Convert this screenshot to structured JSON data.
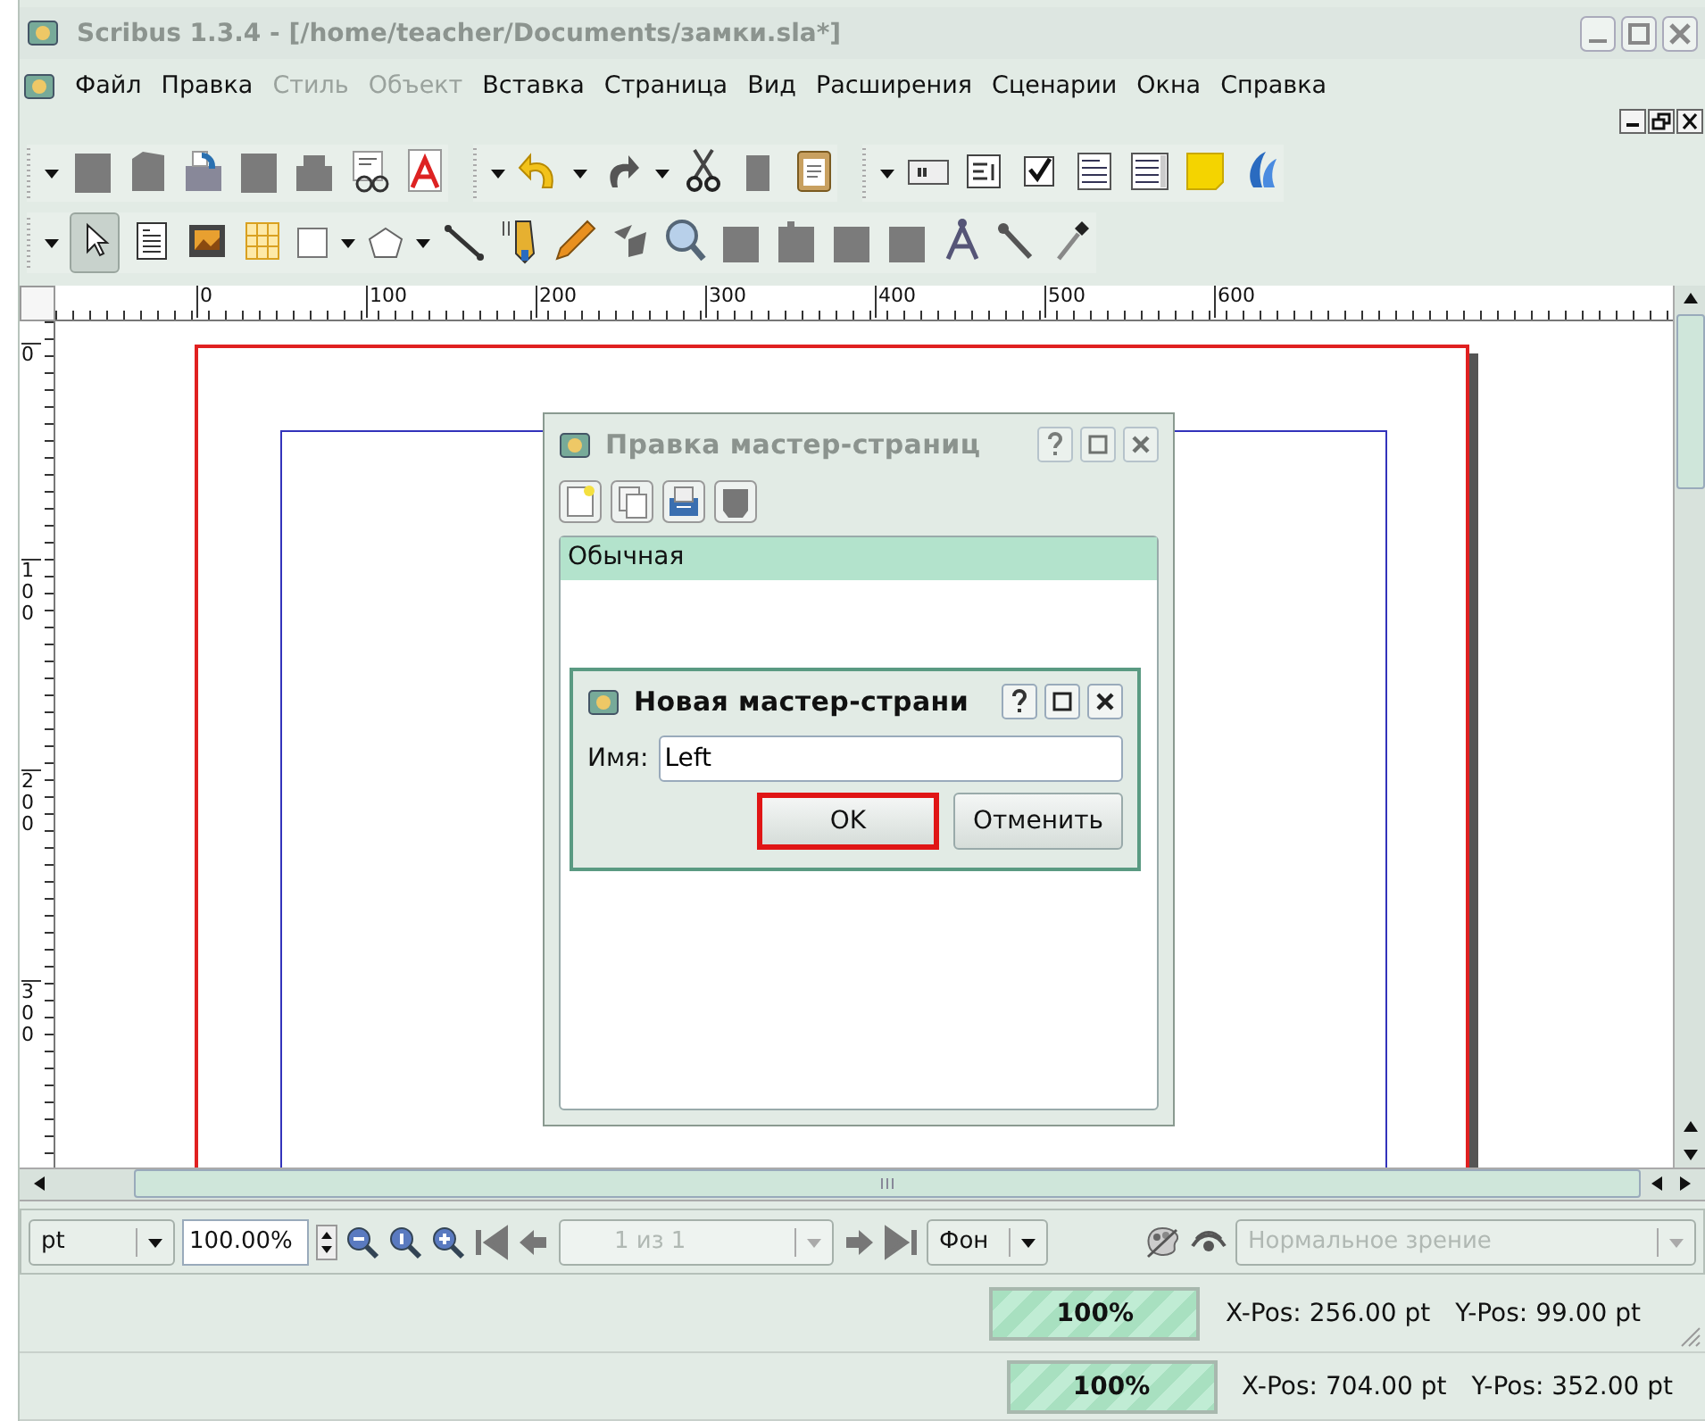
{
  "window": {
    "title": "Scribus 1.3.4 - [/home/teacher/Documents/замки.sla*]"
  },
  "menu": [
    {
      "label": "Файл",
      "disabled": false
    },
    {
      "label": "Правка",
      "disabled": false
    },
    {
      "label": "Стиль",
      "disabled": true
    },
    {
      "label": "Объект",
      "disabled": true
    },
    {
      "label": "Вставка",
      "disabled": false
    },
    {
      "label": "Страница",
      "disabled": false
    },
    {
      "label": "Вид",
      "disabled": false
    },
    {
      "label": "Расширения",
      "disabled": false
    },
    {
      "label": "Сценарии",
      "disabled": false
    },
    {
      "label": "Окна",
      "disabled": false
    },
    {
      "label": "Справка",
      "disabled": false
    }
  ],
  "rulers": {
    "horizontal": [
      "0",
      "100",
      "200",
      "300",
      "400",
      "500",
      "600"
    ],
    "vertical": [
      "0",
      "100",
      "200",
      "300"
    ]
  },
  "master_pages_dialog": {
    "title": "Правка мастер-страниц",
    "items": [
      {
        "label": "Обычная",
        "selected": true
      }
    ]
  },
  "new_master_dialog": {
    "title": "Новая мастер-страни",
    "field_label": "Имя:",
    "value": "Left",
    "buttons": [
      {
        "label": "OK",
        "highlighted": true
      },
      {
        "label": "Отменить",
        "highlighted": false
      }
    ]
  },
  "bottom_bar": {
    "unit": "pt",
    "zoom": "100.00%",
    "page": "1 из 1",
    "layer": "Фон",
    "view_mode": "Нормальное зрение"
  },
  "status_bars": [
    {
      "progress": "100%",
      "level": 1,
      "x_pos": "X-Pos: 256.00 pt",
      "y_pos": "Y-Pos: 99.00 pt"
    },
    {
      "progress": "100%",
      "level": 1,
      "x_pos": "X-Pos: 704.00 pt",
      "y_pos": "Y-Pos: 352.00 pt"
    }
  ]
}
